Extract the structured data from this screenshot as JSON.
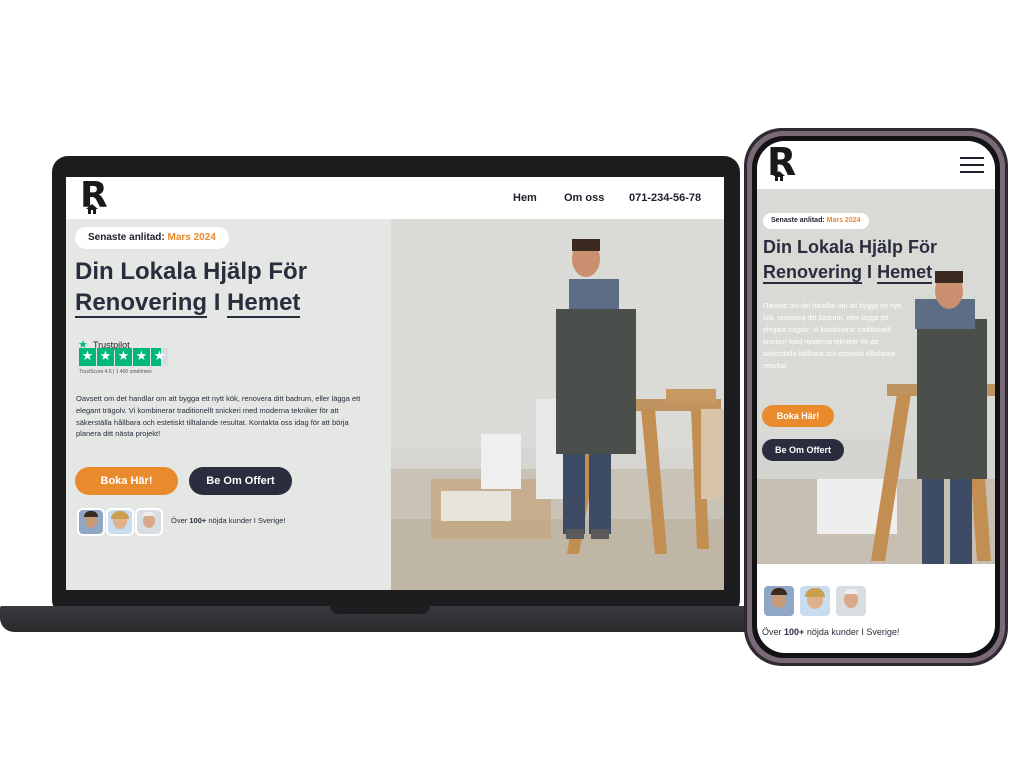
{
  "brand": {
    "logo_letter": "R"
  },
  "nav": {
    "items": [
      "Hem",
      "Om oss"
    ],
    "phone": "071-234-56-78"
  },
  "hero": {
    "badge_prefix": "Senaste anlitad:",
    "badge_date": "Mars 2024",
    "title_line1": "Din Lokala Hjälp För",
    "title_word1": "Renovering",
    "title_mid": "I",
    "title_word2": "Hemet",
    "trustpilot": {
      "label": "Trustpilot",
      "score_text": "TrustScore 4.6",
      "reviews_text": "1 400 omdömen",
      "rating": 4.6
    },
    "description": "Oavsett om det handlar om att bygga ett nytt kök, renovera ditt badrum, eller lägga ett elegant trägolv. Vi kombinerar traditionellt snickeri med moderna tekniker för att säkerställa hållbara och estetiskt tilltalande resultat. Kontakta oss idag för att börja planera ditt nästa projekt!",
    "mobile_description": "Oavsett om det handlar om att bygga ett nytt kök, renovera ditt badrum, eller lägga ett elegant trägolv. Vi kombinerar traditionellt snickeri med moderna tekniker för att säkerställa hållbara och estetiskt tilltalande resultat.",
    "cta_primary": "Boka Här!",
    "cta_secondary": "Be Om Offert",
    "customers_pre": "Över",
    "customers_num": "100+",
    "customers_post": "nöjda kunder I Sverige!"
  },
  "colors": {
    "accent": "#e98a2c",
    "dark": "#2a2d3d",
    "hero_bg": "#e4e7e3",
    "trustpilot_green": "#00b67a"
  },
  "icons": [
    "house-logo-icon",
    "hamburger-menu-icon",
    "trustpilot-star-icon"
  ]
}
